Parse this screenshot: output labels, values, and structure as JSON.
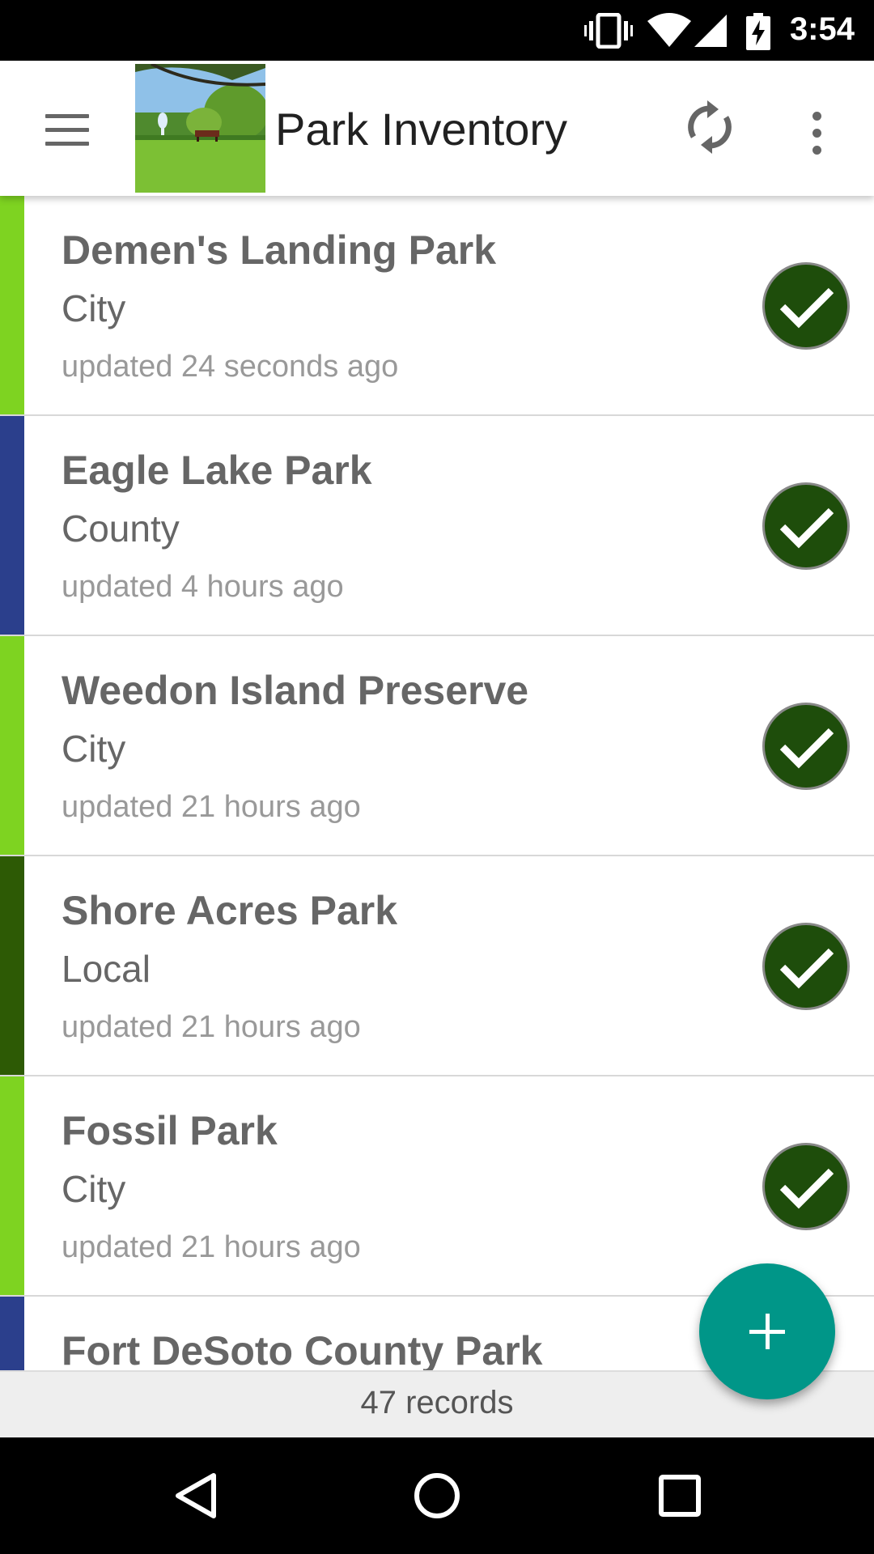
{
  "status_bar": {
    "time": "3:54",
    "icons": [
      "vibrate-icon",
      "wifi-icon",
      "signal-icon",
      "battery-charging-icon"
    ]
  },
  "app_bar": {
    "title": "Park Inventory",
    "menu_icon": "hamburger-menu-icon",
    "logo": "park-photo-logo",
    "sync_icon": "sync-icon",
    "overflow_icon": "more-vertical-icon"
  },
  "records": [
    {
      "name": "Demen's Landing Park",
      "type": "City",
      "updated": "updated 24 seconds ago",
      "color": "#7ed321"
    },
    {
      "name": "Eagle Lake Park",
      "type": "County",
      "updated": "updated 4 hours ago",
      "color": "#2b3f8c"
    },
    {
      "name": "Weedon Island Preserve",
      "type": "City",
      "updated": "updated 21 hours ago",
      "color": "#7ed321"
    },
    {
      "name": "Shore Acres Park",
      "type": "Local",
      "updated": "updated 21 hours ago",
      "color": "#2d5a05"
    },
    {
      "name": "Fossil Park",
      "type": "City",
      "updated": "updated 21 hours ago",
      "color": "#7ed321"
    },
    {
      "name": "Fort DeSoto County Park",
      "type": "",
      "updated": "",
      "color": "#2b3f8c"
    }
  ],
  "colors": {
    "check_fill": "#1e4d0b",
    "fab": "#009688"
  },
  "footer": {
    "count": "47 records"
  },
  "nav_bar": {
    "back_icon": "back-triangle-icon",
    "home_icon": "home-circle-icon",
    "recents_icon": "recents-square-icon"
  }
}
